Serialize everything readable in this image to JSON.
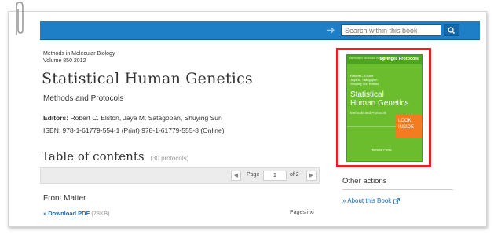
{
  "search": {
    "placeholder": "Search within this book"
  },
  "book": {
    "series": "Methods in Molecular Biology",
    "volume": "Volume 850 2012",
    "title": "Statistical Human Genetics",
    "subtitle": "Methods and Protocols",
    "editors_label": "Editors:",
    "editors": "Robert C. Elston, Jaya M. Satagopan, Shuying Sun",
    "isbn": "ISBN: 978-1-61779-554-1 (Print) 978-1-61779-555-8 (Online)"
  },
  "toc": {
    "heading": "Table of contents",
    "count": "(30 protocols)"
  },
  "pager": {
    "page_label": "Page",
    "current": "1",
    "of_label": "of 2"
  },
  "front_matter": {
    "heading": "Front Matter",
    "download_label": "» Download PDF",
    "download_size": "(78KB)",
    "pages": "Pages i-xi"
  },
  "cover": {
    "series_badge": "Methods in Molecular Biology 850",
    "brand": "Springer Protocols",
    "editors_lines": [
      "Robert C. Elston",
      "Jaya M. Satagopan",
      "Shuying Sun  Editors"
    ],
    "title_line1": "Statistical",
    "title_line2": "Human Genetics",
    "subtitle": "Methods and Protocols",
    "publisher": "Humana Press",
    "look_inside_line1": "LOOK",
    "look_inside_line2": "INSIDE"
  },
  "sidebar": {
    "other_actions": "Other actions",
    "about_link": "» About this Book"
  },
  "colors": {
    "bar": "#1e7fc7",
    "cover_frame": "#e8202a",
    "link": "#1e6fb8",
    "look_inside": "#f47c20"
  }
}
